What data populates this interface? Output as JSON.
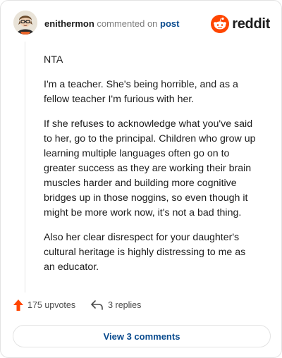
{
  "header": {
    "username": "enithermon",
    "action_text": "commented on",
    "post_link": "post"
  },
  "logo": {
    "wordmark": "reddit",
    "icon": "reddit-snoo-icon",
    "color": "#ff4500"
  },
  "comment": {
    "paragraphs": [
      "NTA",
      "I'm a teacher. She's being horrible, and as a fellow teacher I'm furious with her.",
      "If she refuses to acknowledge what you've said to her, go to the principal. Children who grow up learning multiple languages often go on to greater success as they are working their brain muscles harder and building more cognitive bridges up in those noggins, so even though it might be more work now, it's not a bad thing.",
      "Also her clear disrespect for your daughter's cultural heritage is highly distressing to me as an educator."
    ]
  },
  "actions": {
    "upvotes_label": "175 upvotes",
    "upvote_icon": "upvote-arrow-icon",
    "replies_label": "3 replies",
    "reply_icon": "reply-arrow-icon"
  },
  "view_comments_label": "View 3 comments",
  "colors": {
    "accent": "#ff4500",
    "link": "#0a4b8e",
    "muted": "#7c7c7c"
  }
}
